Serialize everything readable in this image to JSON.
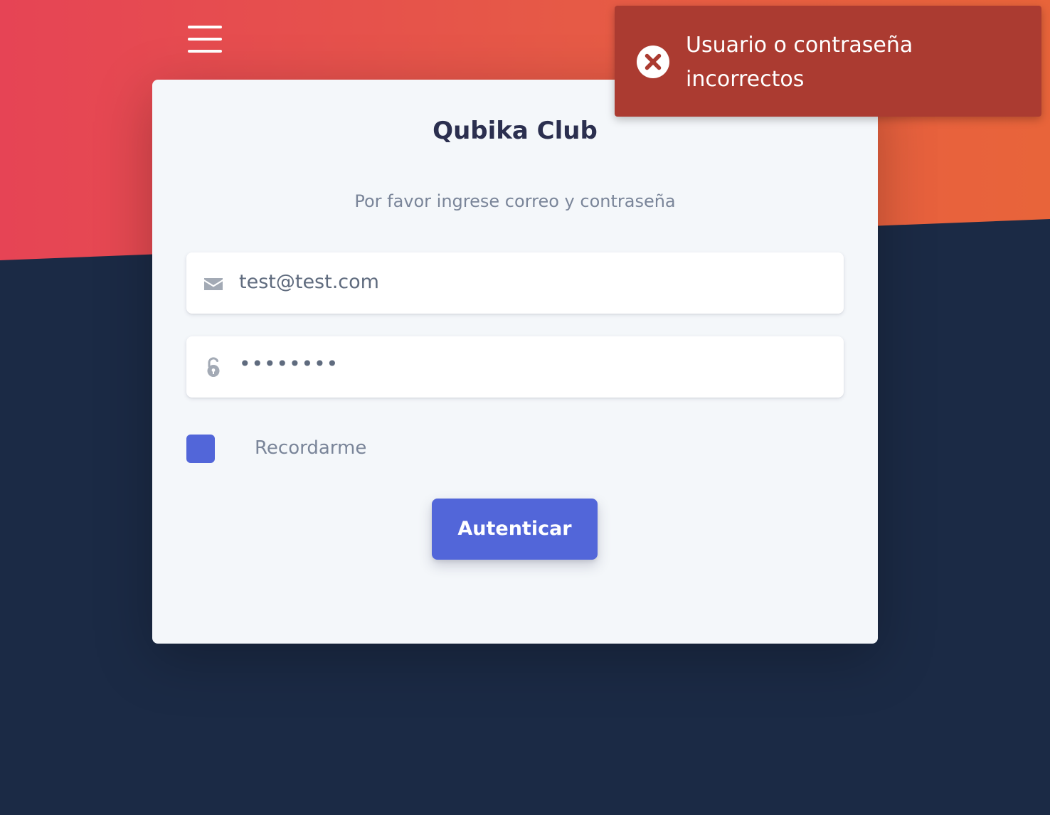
{
  "colors": {
    "accent": "#5266d9",
    "background_dark": "#1b2a45",
    "header_gradient_start": "#e64455",
    "header_gradient_end": "#e8643a",
    "toast_error": "#ab3b31"
  },
  "header": {
    "menu_icon": "hamburger-menu-icon"
  },
  "login": {
    "title": "Qubika Club",
    "subtitle": "Por favor ingrese correo y contraseña",
    "email": {
      "icon": "envelope-icon",
      "value": "test@test.com"
    },
    "password": {
      "icon": "unlock-icon",
      "value": "••••••••"
    },
    "remember": {
      "label": "Recordarme",
      "checked": false
    },
    "submit_label": "Autenticar"
  },
  "toast": {
    "icon": "error-circle-icon",
    "message": "Usuario o contraseña incorrectos"
  }
}
